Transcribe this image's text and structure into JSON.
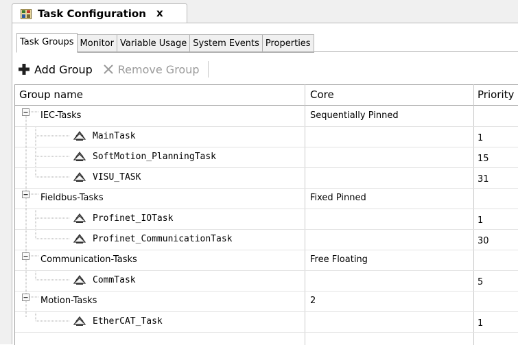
{
  "document_tab": {
    "title": "Task Configuration",
    "close_label": "x"
  },
  "subtabs": [
    "Task Groups",
    "Monitor",
    "Variable Usage",
    "System Events",
    "Properties"
  ],
  "toolbar": {
    "add_label": "Add Group",
    "remove_label": "Remove Group"
  },
  "columns": [
    "Group name",
    "Core",
    "Priority"
  ],
  "groups": [
    {
      "name": "IEC-Tasks",
      "core": "Sequentially Pinned",
      "tasks": [
        {
          "name": "MainTask",
          "priority": "1"
        },
        {
          "name": "SoftMotion_PlanningTask",
          "priority": "15"
        },
        {
          "name": "VISU_TASK",
          "priority": "31"
        }
      ]
    },
    {
      "name": "Fieldbus-Tasks",
      "core": "Fixed Pinned",
      "tasks": [
        {
          "name": "Profinet_IOTask",
          "priority": "1"
        },
        {
          "name": "Profinet_CommunicationTask",
          "priority": "30"
        }
      ]
    },
    {
      "name": "Communication-Tasks",
      "core": "Free Floating",
      "tasks": [
        {
          "name": "CommTask",
          "priority": "5"
        }
      ]
    },
    {
      "name": "Motion-Tasks",
      "core": "2",
      "tasks": [
        {
          "name": "EtherCAT_Task",
          "priority": "1"
        }
      ]
    }
  ],
  "colors": {
    "border": "#a0a0a0",
    "row_line": "#e3e3e3",
    "disabled": "#9a9a9a"
  }
}
